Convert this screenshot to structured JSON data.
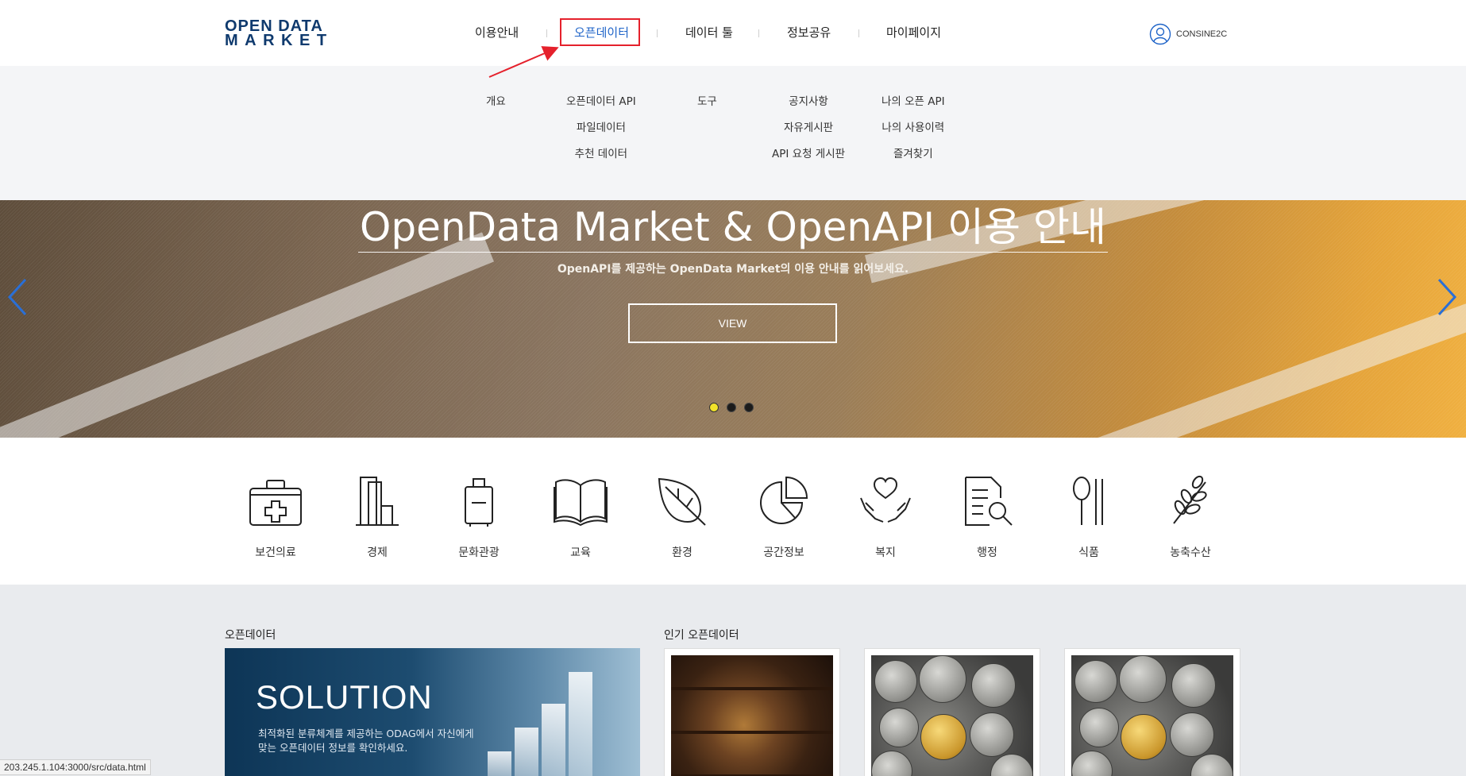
{
  "logo": {
    "line1": "OPEN DATA",
    "line2": "MARKET"
  },
  "nav": {
    "items": [
      {
        "label": "이용안내"
      },
      {
        "label": "오픈데이터"
      },
      {
        "label": "데이터 툴"
      },
      {
        "label": "정보공유"
      },
      {
        "label": "마이페이지"
      }
    ],
    "active_index": 1
  },
  "user": {
    "name": "CONSINE2C",
    "icon": "user-circle-icon"
  },
  "mega_menu": {
    "columns": [
      {
        "items": [
          "개요"
        ]
      },
      {
        "items": [
          "오픈데이터 API",
          "파일데이터",
          "추천 데이터"
        ]
      },
      {
        "items": [
          "도구"
        ]
      },
      {
        "items": [
          "공지사항",
          "자유게시판",
          "API 요청 게시판"
        ]
      },
      {
        "items": [
          "나의 오픈 API",
          "나의 사용이력",
          "즐겨찾기"
        ]
      }
    ]
  },
  "hero": {
    "title": "OpenData Market & OpenAPI 이용 안내",
    "subtitle": "OpenAPI를 제공하는 OpenData Market의 이용 안내를 읽어보세요.",
    "button": "VIEW",
    "slide_count": 3,
    "active_slide": 0
  },
  "categories": [
    {
      "label": "보건의료",
      "icon": "medical-kit-icon"
    },
    {
      "label": "경제",
      "icon": "buildings-icon"
    },
    {
      "label": "문화관광",
      "icon": "luggage-icon"
    },
    {
      "label": "교육",
      "icon": "open-book-icon"
    },
    {
      "label": "환경",
      "icon": "leaf-icon"
    },
    {
      "label": "공간정보",
      "icon": "pie-chart-icon"
    },
    {
      "label": "복지",
      "icon": "hands-heart-icon"
    },
    {
      "label": "행정",
      "icon": "document-search-icon"
    },
    {
      "label": "식품",
      "icon": "spoon-chopsticks-icon"
    },
    {
      "label": "농축수산",
      "icon": "wheat-icon"
    }
  ],
  "open_data": {
    "section_title": "오픈데이터",
    "banner_title": "SOLUTION",
    "banner_desc_line1": "최적화된 분류체계를 제공하는 ODAG에서 자신에게",
    "banner_desc_line2": "맞는 오픈데이터 정보를 확인하세요."
  },
  "popular": {
    "section_title": "인기 오픈데이터",
    "cards": [
      {
        "image": "bookshelf"
      },
      {
        "image": "coins"
      },
      {
        "image": "coins"
      }
    ]
  },
  "status_url": "203.245.1.104:3000/src/data.html",
  "colors": {
    "brand": "#0f3a6e",
    "active_nav": "#1f64c8",
    "highlight": "#e5212c",
    "dot_active": "#f2e22a"
  }
}
